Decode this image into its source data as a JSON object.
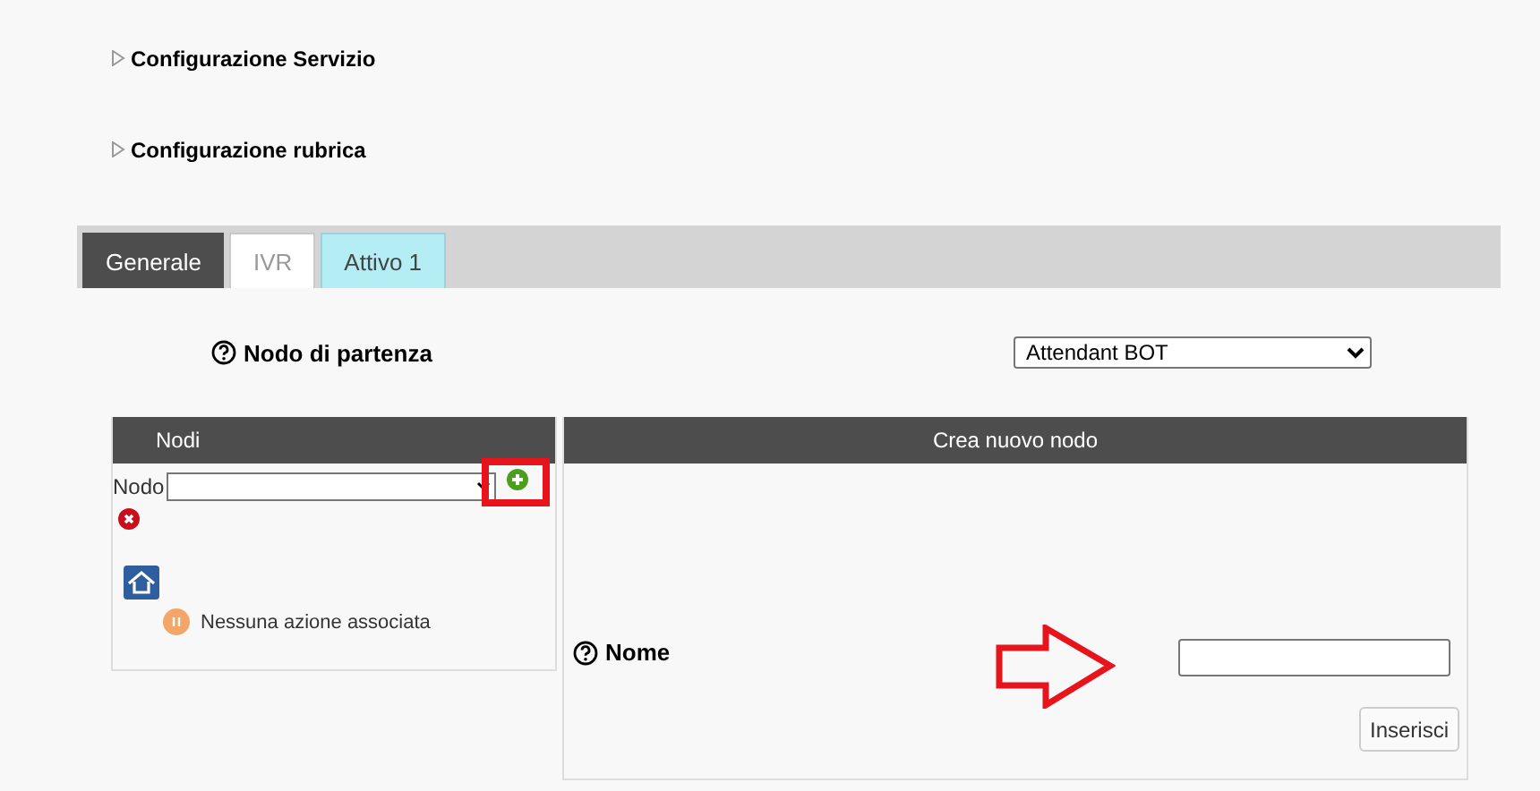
{
  "sections": [
    {
      "label": "Configurazione Servizio",
      "expanded": false
    },
    {
      "label": "Configurazione rubrica",
      "expanded": false
    }
  ],
  "tabs": [
    {
      "label": "Generale",
      "selected": true,
      "highlighted": false
    },
    {
      "label": "IVR",
      "selected": false,
      "highlighted": false
    },
    {
      "label": "Attivo 1",
      "selected": false,
      "highlighted": true
    }
  ],
  "start_node": {
    "label": "Nodo di partenza",
    "value": "Attendant BOT"
  },
  "nodes_panel": {
    "title": "Nodi",
    "node_label": "Nodo",
    "add_button_boxed": true,
    "tree": [
      {
        "kind": "root",
        "children": [
          {
            "kind": "action",
            "label": "Nessuna azione associata"
          }
        ]
      }
    ]
  },
  "create_panel": {
    "title": "Crea nuovo nodo",
    "name_label": "Nome",
    "button": "Inserisci",
    "name_field_arrow": true
  }
}
